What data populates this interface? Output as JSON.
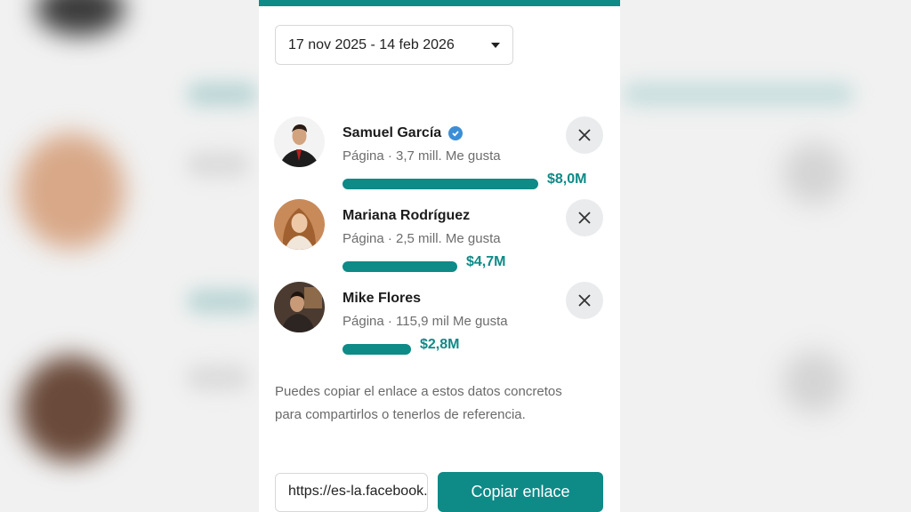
{
  "date_range": {
    "label": "17 nov 2025 - 14 feb 2026"
  },
  "pages": [
    {
      "name": "Samuel García",
      "verified": true,
      "subtitle": "Página · 3,7 mill. Me gusta",
      "amount": "$8,0M",
      "spend_millions": 8.0
    },
    {
      "name": "Mariana Rodríguez",
      "verified": false,
      "subtitle": "Página · 2,5 mill. Me gusta",
      "amount": "$4,7M",
      "spend_millions": 4.7
    },
    {
      "name": "Mike Flores",
      "verified": false,
      "subtitle": "Página · 115,9 mil Me gusta",
      "amount": "$2,8M",
      "spend_millions": 2.8
    }
  ],
  "info_text": "Puedes copiar el enlace a estos datos concretos para compartirlos o tenerlos de referencia.",
  "link": {
    "value": "https://es-la.facebook.com"
  },
  "copy_button": {
    "label": "Copiar enlace"
  },
  "colors": {
    "accent": "#0e8a87",
    "verified": "#3b8ed6"
  }
}
